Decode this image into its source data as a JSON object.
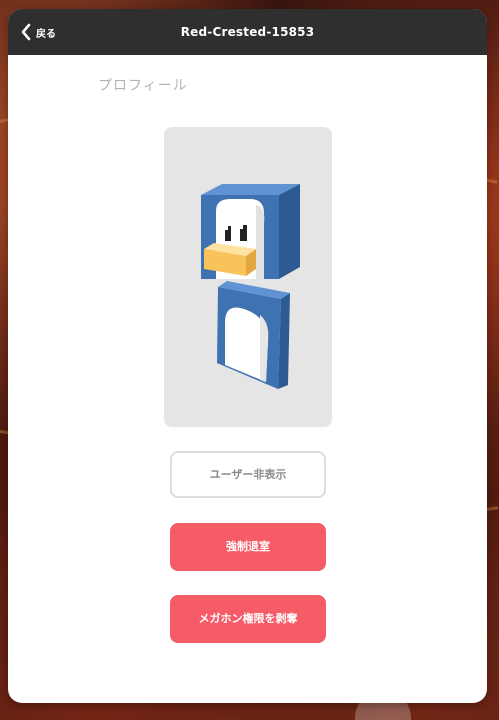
{
  "header": {
    "back_label": "戻る",
    "title": "Red-Crested-15853"
  },
  "profile": {
    "section_label": "プロフィール",
    "avatar_icon": "penguin-avatar"
  },
  "actions": {
    "hide_user_label": "ユーザー非表示",
    "kick_label": "強制退室",
    "revoke_megaphone_label": "メガホン権限を剥奪"
  },
  "colors": {
    "header_bg": "#2f2f2f",
    "danger": "#f55c68",
    "avatar_bg": "#e5e5e5",
    "penguin_blue": "#3f72b0",
    "beak": "#f7c35a"
  }
}
